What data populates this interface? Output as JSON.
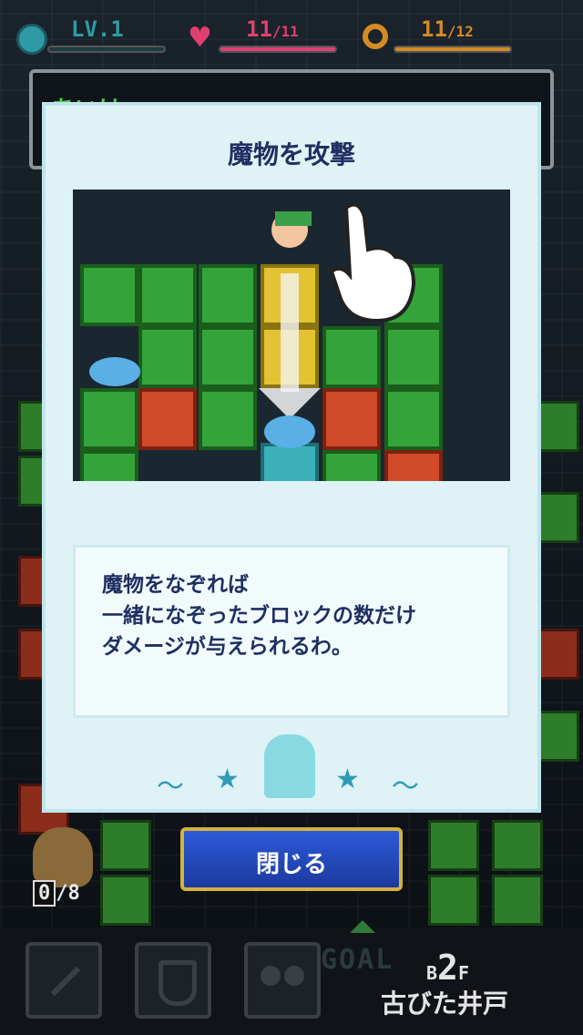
{
  "hud": {
    "level": "LV.1",
    "hp": "11",
    "hp_max": "/11",
    "stamina": "11",
    "stamina_max": "/12",
    "colors": {
      "level_accent": "#2f9aa5",
      "hp_accent": "#e0406f",
      "stamina_accent": "#d48a25"
    }
  },
  "message_box": {
    "partial_text": "あいは"
  },
  "tutorial": {
    "title": "魔物を攻撃",
    "description": [
      "魔物をなぞれば",
      "一緒になぞったブロックの数だけ",
      "ダメージが与えられるわ。"
    ]
  },
  "close_button": {
    "label": "閉じる"
  },
  "inventory": {
    "bag_count": "0",
    "bag_max": "/8"
  },
  "footer": {
    "goal_label": "GOAL",
    "floor_prefix": "B",
    "floor_number": "2",
    "floor_suffix": "F",
    "location_name": "古びた井戸"
  }
}
